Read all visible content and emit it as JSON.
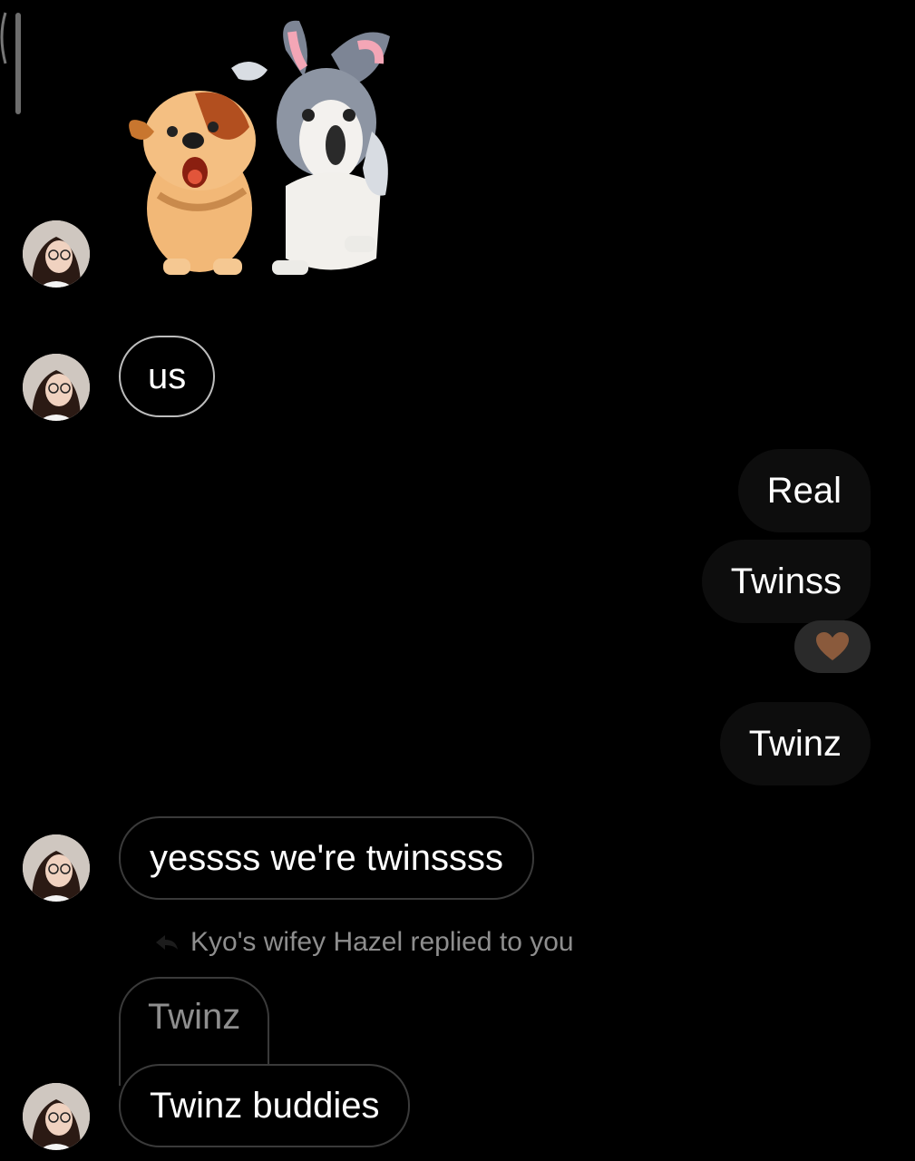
{
  "sticker": {
    "name": "two-cartoon-dogs-sticker"
  },
  "messages": {
    "us": "us",
    "real": "Real",
    "twinss": "Twinss",
    "twinz_out": "Twinz",
    "yessss": "yessss we're twinssss",
    "reply_label": "Kyo's wifey Hazel replied to you",
    "quoted": "Twinz",
    "twinz_buddies": "Twinz buddies"
  },
  "reaction": {
    "icon": "brown-heart-icon",
    "color": "#8a5a3c"
  },
  "colors": {
    "background": "#000000",
    "outgoing_bubble": "#0d0d0d",
    "incoming_border": "#3a3a3a",
    "muted_text": "#8e8e8e"
  }
}
